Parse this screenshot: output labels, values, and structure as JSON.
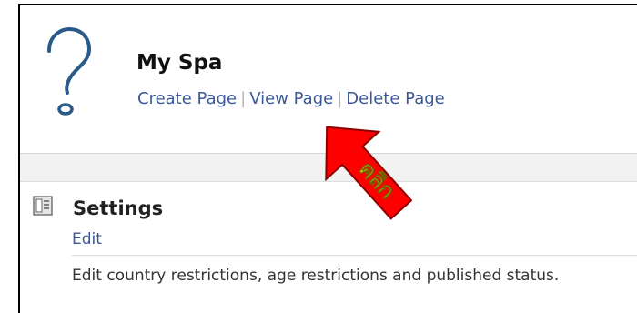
{
  "page": {
    "title": "My Spa",
    "links": [
      {
        "label": "Create Page"
      },
      {
        "label": "View Page"
      },
      {
        "label": "Delete Page"
      }
    ],
    "separator": "|"
  },
  "settings": {
    "title": "Settings",
    "edit_label": "Edit",
    "description": "Edit country restrictions, age restrictions and published status."
  },
  "annotation": {
    "label": "คลิก",
    "arrow_color": "#ff0000",
    "text_color": "#ffff00"
  },
  "icons": {
    "page_picture": "question-mark-icon",
    "settings": "settings-icon"
  }
}
